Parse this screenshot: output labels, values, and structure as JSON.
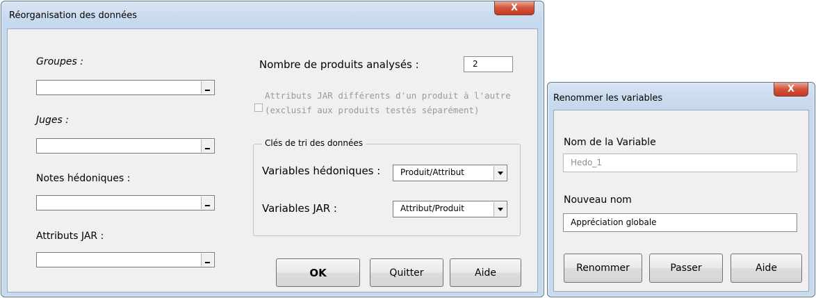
{
  "dialog1": {
    "title": "Réorganisation des données",
    "close_label": "X",
    "fields": {
      "groupes": {
        "label": "Groupes :",
        "value": ""
      },
      "juges": {
        "label": "Juges :",
        "value": ""
      },
      "notes": {
        "label": "Notes hédoniques :",
        "value": ""
      },
      "attributs": {
        "label": "Attributs JAR :",
        "value": ""
      }
    },
    "nombre_label": "Nombre de produits analysés :",
    "nombre_value": "2",
    "checkbox_line1": "Attributs JAR différents d'un produit à l'autre",
    "checkbox_line2": "(exclusif aux produits testés séparément)",
    "checkbox_checked": false,
    "frame_title": "Clés de tri des données",
    "hedo_label": "Variables hédoniques :",
    "hedo_value": "Produit/Attribut",
    "jar_label": "Variables JAR :",
    "jar_value": "Attribut/Produit",
    "ok_label": "OK",
    "quitter_label": "Quitter",
    "aide_label": "Aide"
  },
  "dialog2": {
    "title": "Renommer les variables",
    "close_label": "X",
    "nom_label": "Nom de la Variable",
    "nom_value": "Hedo_1",
    "nouveau_label": "Nouveau nom",
    "nouveau_value": "Appréciation globale",
    "renommer_label": "Renommer",
    "passer_label": "Passer",
    "aide_label": "Aide"
  },
  "colors": {
    "titlebar": "#c7d9ee",
    "client": "#f0f0f0",
    "close_button": "#c23a22"
  }
}
